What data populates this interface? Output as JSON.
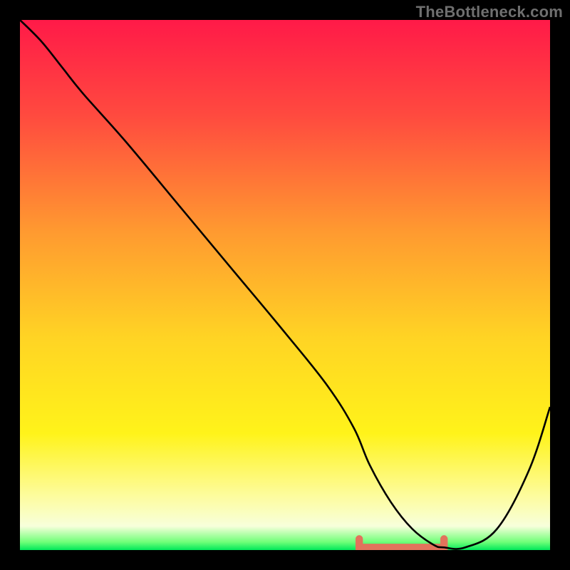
{
  "watermark": "TheBottleneck.com",
  "chart_data": {
    "type": "line",
    "title": "",
    "xlabel": "",
    "ylabel": "",
    "xlim": [
      0,
      100
    ],
    "ylim": [
      0,
      100
    ],
    "grid": false,
    "legend": false,
    "series": [
      {
        "name": "curve",
        "x": [
          0,
          4,
          8,
          12,
          20,
          30,
          40,
          50,
          58,
          63,
          66,
          70,
          74,
          78,
          80,
          84,
          90,
          96,
          100
        ],
        "y": [
          100,
          96,
          91,
          86,
          77,
          65,
          53,
          41,
          31,
          23,
          16,
          9,
          4,
          1,
          0.5,
          0.5,
          4,
          15,
          27
        ]
      }
    ],
    "optimal_band": {
      "x_range": [
        64,
        80
      ],
      "y": 0.5
    },
    "gradient_stops": [
      {
        "offset": 0.0,
        "color": "#ff1a48"
      },
      {
        "offset": 0.18,
        "color": "#ff4a3f"
      },
      {
        "offset": 0.4,
        "color": "#ff9a30"
      },
      {
        "offset": 0.6,
        "color": "#ffd424"
      },
      {
        "offset": 0.78,
        "color": "#fff31a"
      },
      {
        "offset": 0.9,
        "color": "#fdfca0"
      },
      {
        "offset": 0.955,
        "color": "#f7ffdb"
      },
      {
        "offset": 0.985,
        "color": "#6fff78"
      },
      {
        "offset": 1.0,
        "color": "#00e85a"
      }
    ]
  }
}
